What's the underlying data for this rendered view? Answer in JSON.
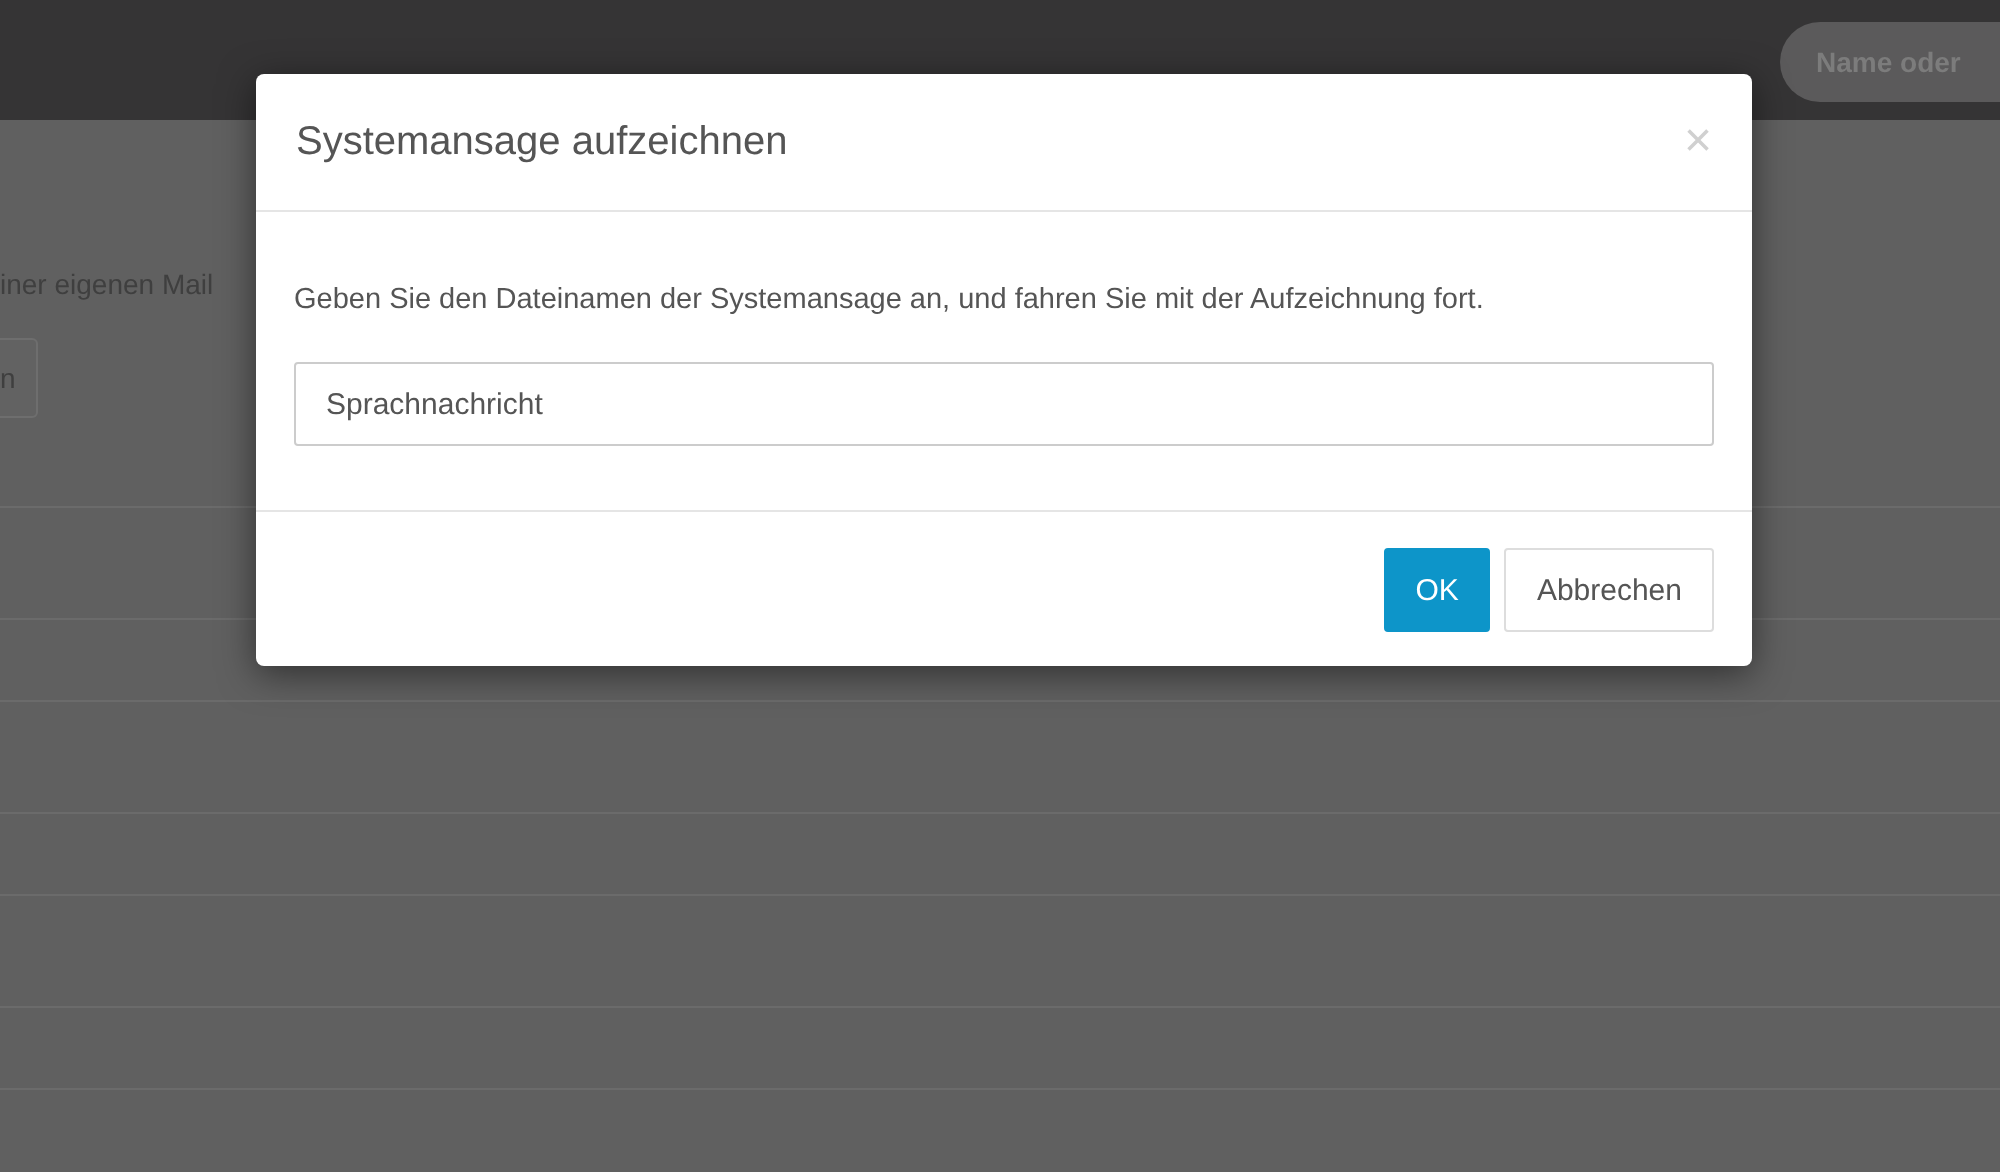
{
  "topbar": {
    "search": {
      "placeholder": "Name oder"
    }
  },
  "background": {
    "text": "iner eigenen Mail",
    "button": "n"
  },
  "dialog": {
    "title": "Systemansage aufzeichnen",
    "close": "×",
    "message": "Geben Sie den Dateinamen der Systemansage an, und fahren Sie mit der Aufzeichnung fort.",
    "field": {
      "value": "Sprachnachricht"
    },
    "buttons": [
      {
        "label": "OK",
        "kind": "primary"
      },
      {
        "label": "Abbrechen",
        "kind": "secondary"
      }
    ]
  }
}
